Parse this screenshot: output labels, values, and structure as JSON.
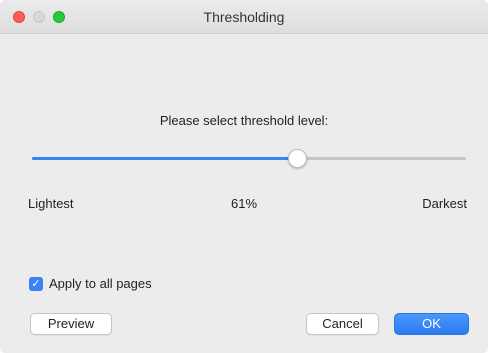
{
  "window": {
    "title": "Thresholding"
  },
  "dialog": {
    "prompt": "Please select threshold level:",
    "slider": {
      "value_percent": 61,
      "min_label": "Lightest",
      "value_label": "61%",
      "max_label": "Darkest",
      "accent_color": "#3b82f6"
    },
    "apply_all": {
      "label": "Apply to all pages",
      "checked": true
    }
  },
  "buttons": {
    "preview": "Preview",
    "cancel": "Cancel",
    "ok": "OK"
  }
}
